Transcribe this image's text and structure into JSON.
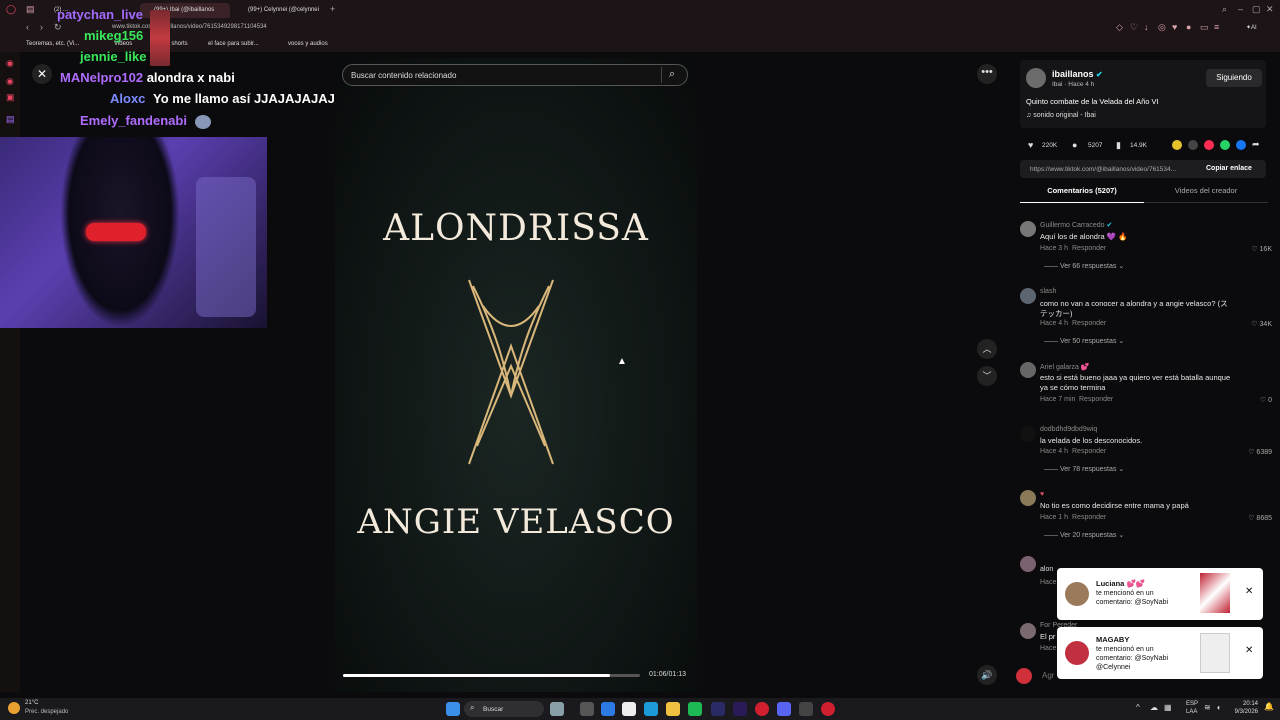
{
  "browser": {
    "tabs": [
      "(2) ...",
      "(99+) Ibai (@ibaillanos",
      "(99+) Celynnei (@celynnei"
    ],
    "url": "www.tiktok.com/@ibaillanos/video/7615349298171104534",
    "bookmarks": [
      "Teoremas, etc. (Vi...",
      "Videos",
      "y subir shorts",
      "el face para subir...",
      "voces y audios"
    ]
  },
  "chat": {
    "messages": [
      {
        "user": "patychan_live",
        "text": "",
        "color": "#a36bff"
      },
      {
        "user": "mikeg156",
        "text": "",
        "color": "#39e85a"
      },
      {
        "user": "jennie_like",
        "text": "",
        "color": "#39e85a"
      },
      {
        "user": "MANelpro102",
        "text": "alondra x nabi",
        "color": "#b06cff"
      },
      {
        "user": "Aloxc",
        "text": "Yo me llamo así JJAJAJAJAJ",
        "color": "#7d8cff"
      },
      {
        "user": "Emely_fandenabi",
        "text": "",
        "color": "#b06cff"
      }
    ]
  },
  "player": {
    "search_placeholder": "Buscar contenido relacionado",
    "title_top": "ALONDRISSA",
    "title_bottom": "ANGIE VELASCO",
    "time": "01:06/01:13",
    "progress": 0.9
  },
  "video_info": {
    "author": "ibaillanos",
    "sub": "Ibai · Hace 4 h",
    "follow_label": "Siguiendo",
    "description": "Quinto combate de la Velada del Año VI",
    "sound": "sonido original - Ibai",
    "likes": "220K",
    "comments": "5207",
    "saves": "14.9K",
    "link": "https://www.tiktok.com/@ibaillanos/video/761534...",
    "copy_label": "Copiar enlace",
    "tabs": [
      "Comentarios (5207)",
      "Videos del creador"
    ]
  },
  "comments": [
    {
      "name": "Guillermo Carracedo",
      "text": "Aquí los de alondra",
      "meta": "Hace 3 h",
      "reply": "Responder",
      "likes": "16K",
      "replies": "Ver 66 respuestas"
    },
    {
      "name": "slash",
      "text": "como no van a conocer a alondra y a angie velasco? (ス",
      "text2": "テッカー)",
      "meta": "Hace 4 h",
      "reply": "Responder",
      "likes": "34K",
      "replies": "Ver 50 respuestas"
    },
    {
      "name": "Ariel galarza",
      "text": "esto si está bueno jaaa ya quiero ver está batalla aunque",
      "text2": "ya se cómo termina",
      "meta": "Hace 7 min",
      "reply": "Responder",
      "likes": "0",
      "replies": ""
    },
    {
      "name": "dodbdhd9dbd9wiq",
      "text": "la velada de los desconocidos.",
      "meta": "Hace 4 h",
      "reply": "Responder",
      "likes": "6389",
      "replies": "Ver 78 respuestas"
    },
    {
      "name": "",
      "text": "No tio es como decidirse entre mama y papá",
      "meta": "Hace 1 h",
      "reply": "Responder",
      "likes": "8685",
      "replies": "Ver 20 respuestas"
    },
    {
      "name": "alon",
      "text": "",
      "meta": "Hace",
      "reply": "",
      "likes": "",
      "replies": ""
    },
    {
      "name": "For Pereder",
      "text": "El pr",
      "meta": "Hace",
      "reply": "",
      "likes": "",
      "replies": ""
    }
  ],
  "notifications": [
    {
      "user": "Luciana",
      "line1": "te mencionó en un",
      "line2": "comentario: @SoyNabi",
      "line3": ""
    },
    {
      "user": "MAGABY",
      "line1": "te mencionó en un",
      "line2": "comentario: @SoyNabi",
      "line3": "@Celynnei"
    }
  ],
  "comment_input_placeholder": "Agr",
  "taskbar": {
    "weather_temp": "21°C",
    "weather_desc": "Prec. despejado",
    "search_label": "Buscar",
    "lang": "ESP",
    "lang2": "LAA",
    "time": "20:14",
    "date": "9/3/2026"
  },
  "colors": {
    "accent": "#fe2c55",
    "verified": "#20d5ec"
  }
}
